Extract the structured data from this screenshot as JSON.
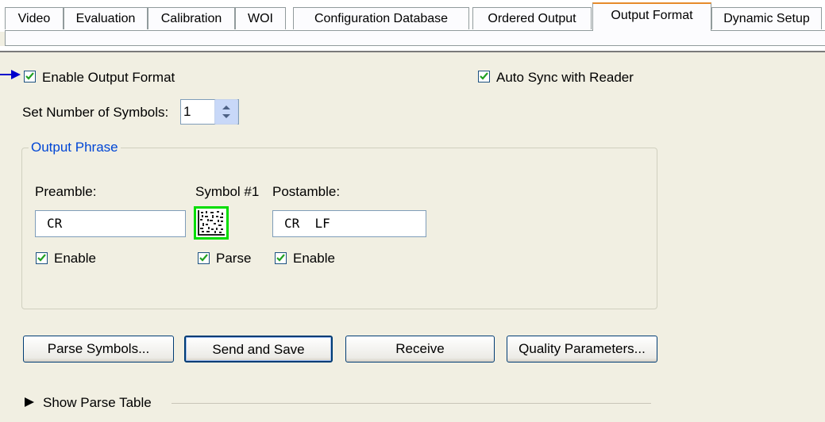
{
  "tabs": [
    {
      "label": "Video"
    },
    {
      "label": "Evaluation"
    },
    {
      "label": "Calibration"
    },
    {
      "label": "WOI"
    },
    {
      "label": "Configuration Database"
    },
    {
      "label": "Ordered Output"
    },
    {
      "label": "Output Format"
    },
    {
      "label": "Dynamic Setup"
    }
  ],
  "active_tab": "Output Format",
  "enable_output_format": {
    "label": "Enable Output Format",
    "checked": true
  },
  "auto_sync": {
    "label": "Auto Sync with Reader",
    "checked": true
  },
  "num_symbols": {
    "label": "Set Number of Symbols:",
    "value": "1"
  },
  "output_phrase": {
    "title": "Output Phrase",
    "preamble": {
      "label": "Preamble:",
      "value": "CR",
      "enable_label": "Enable",
      "enable_checked": true
    },
    "symbol": {
      "label": "Symbol #1",
      "parse_label": "Parse",
      "parse_checked": true
    },
    "postamble": {
      "label": "Postamble:",
      "value": "CR  LF",
      "enable_label": "Enable",
      "enable_checked": true
    }
  },
  "buttons": {
    "parse_symbols": "Parse Symbols...",
    "send_and_save": "Send and Save",
    "receive": "Receive",
    "quality_parameters": "Quality Parameters..."
  },
  "parse_table": {
    "label": "Show Parse Table"
  },
  "colors": {
    "accent": "#0046d5",
    "check": "#21a121",
    "tab_highlight": "#e68b2c",
    "callout_arrow": "#0000cc"
  }
}
